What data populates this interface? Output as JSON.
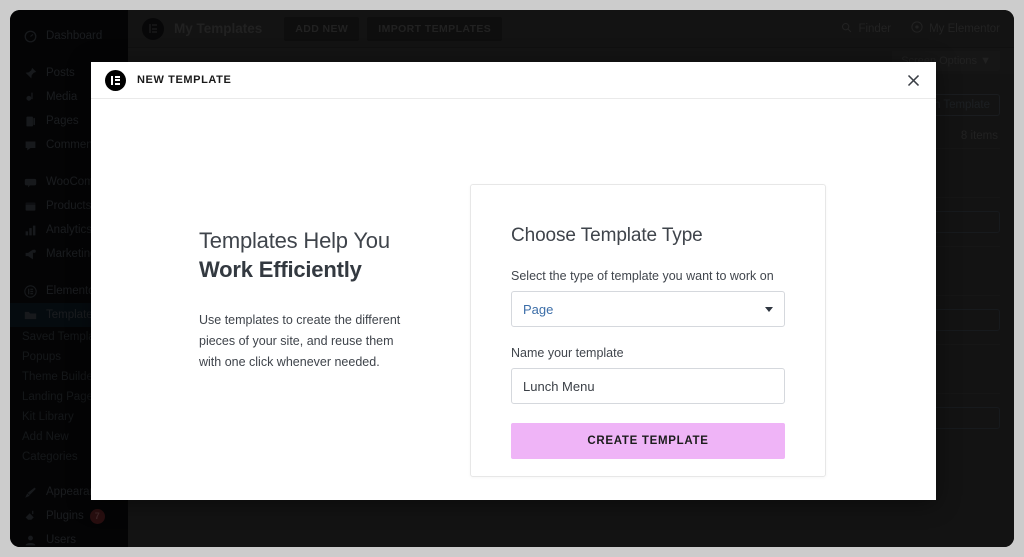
{
  "sidebar": {
    "items": [
      {
        "label": "Dashboard",
        "icon": "dashboard-icon",
        "active": false
      },
      {
        "label": "Posts",
        "icon": "pin-icon",
        "active": false
      },
      {
        "label": "Media",
        "icon": "media-icon",
        "active": false
      },
      {
        "label": "Pages",
        "icon": "pages-icon",
        "active": false
      },
      {
        "label": "Comments",
        "icon": "comments-icon",
        "active": false
      },
      {
        "label": "WooCommerce",
        "icon": "woocommerce-icon",
        "active": false
      },
      {
        "label": "Products",
        "icon": "products-icon",
        "active": false
      },
      {
        "label": "Analytics",
        "icon": "analytics-icon",
        "active": false
      },
      {
        "label": "Marketing",
        "icon": "megaphone-icon",
        "active": false
      },
      {
        "label": "Elementor",
        "icon": "elementor-icon",
        "active": false
      },
      {
        "label": "Templates",
        "icon": "folder-icon",
        "active": true
      }
    ],
    "submenu": [
      "Saved Templates",
      "Popups",
      "Theme Builder",
      "Landing Pages",
      "Kit Library",
      "Add New",
      "Categories"
    ],
    "footer_items": [
      {
        "label": "Appearance",
        "icon": "brush-icon",
        "badge": ""
      },
      {
        "label": "Plugins",
        "icon": "plug-icon",
        "badge": "7"
      },
      {
        "label": "Users",
        "icon": "user-icon",
        "badge": ""
      }
    ]
  },
  "topbar": {
    "title": "My Templates",
    "add_new_label": "ADD NEW",
    "import_label": "IMPORT TEMPLATES",
    "finder_label": "Finder",
    "my_elementor_label": "My Elementor",
    "screen_options_label": "Screen Options"
  },
  "admin_body": {
    "search_button_label": "Search Template",
    "items_count": "8 items"
  },
  "modal": {
    "title": "NEW TEMPLATE",
    "close_icon": "close-icon",
    "promo": {
      "heading_line1": "Templates Help You",
      "heading_line2": "Work Efficiently",
      "body": "Use templates to create the different pieces of your site, and reuse them with one click whenever needed."
    },
    "form": {
      "title": "Choose Template Type",
      "type_label": "Select the type of template you want to work on",
      "type_value": "Page",
      "name_label": "Name your template",
      "name_value": "Lunch Menu",
      "name_placeholder": "Name your template",
      "submit_label": "CREATE TEMPLATE"
    }
  },
  "colors": {
    "accent_button": "#efb4f7",
    "select_value": "#3c6ea8",
    "sidebar_active": "#0d1923",
    "badge": "#5a1f22"
  }
}
